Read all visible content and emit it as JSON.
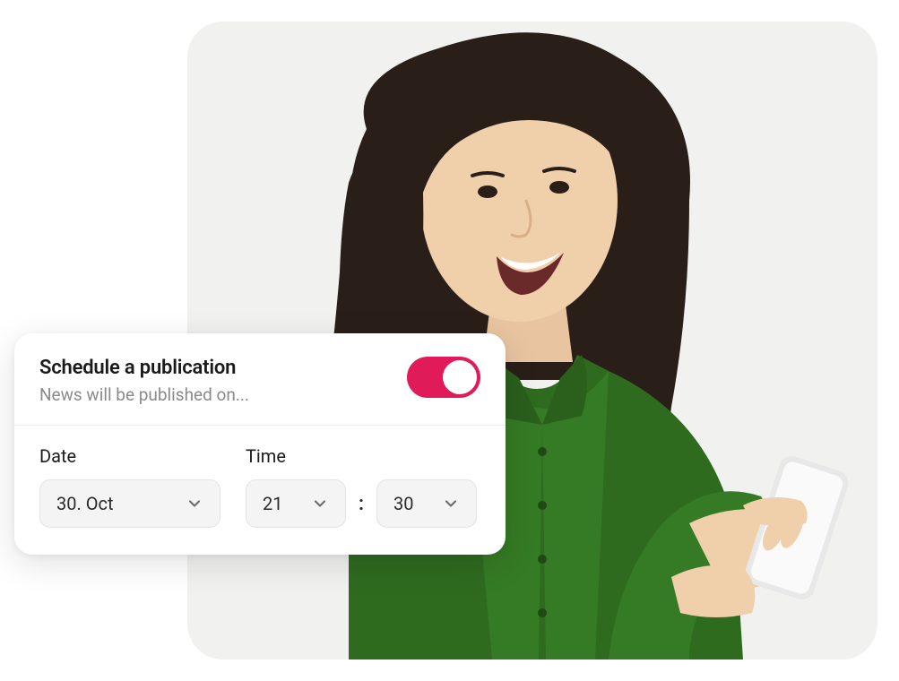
{
  "card": {
    "title": "Schedule a publication",
    "subtitle": "News will be published on...",
    "toggle_on": true,
    "date_label": "Date",
    "time_label": "Time",
    "date_value": "30. Oct",
    "hour_value": "21",
    "minute_value": "30",
    "time_separator": ":"
  },
  "colors": {
    "accent": "#e11b5a"
  }
}
